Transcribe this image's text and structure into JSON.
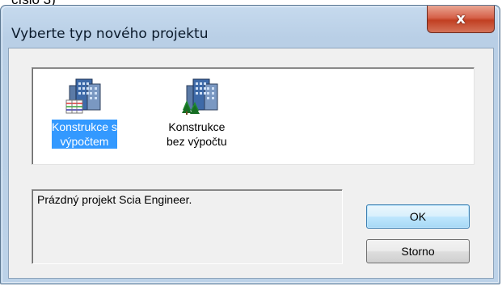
{
  "fragment_text": "císlo 3)",
  "window": {
    "title": "Vyberte typ nového projektu",
    "close_symbol": "x"
  },
  "project_types": [
    {
      "label": "Konstrukce s\nvýpočtem",
      "icon": "buildings-with-table-icon",
      "selected": true
    },
    {
      "label": "Konstrukce\nbez výpočtu",
      "icon": "buildings-with-trees-icon",
      "selected": false
    }
  ],
  "description": "Prázdný projekt Scia Engineer.",
  "buttons": {
    "ok": "OK",
    "cancel": "Storno"
  },
  "colors": {
    "selection": "#3399ff",
    "close_button": "#c13f22",
    "title_bar": "#bcd2e8"
  }
}
